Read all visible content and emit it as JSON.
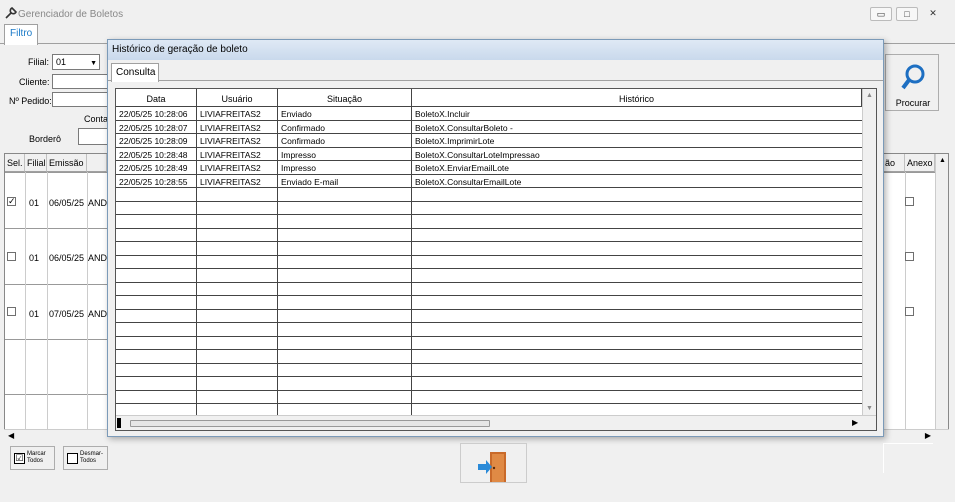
{
  "window": {
    "title": "Gerenciador de Boletos",
    "buttons": {
      "minimize": "▭",
      "maximize": "□",
      "close": "✕"
    }
  },
  "tabs": {
    "filtro": "Filtro"
  },
  "filter": {
    "filial_label": "Filial:",
    "filial_value": "01",
    "cliente_label": "Cliente:",
    "pedido_label": "Nº Pedido:",
    "conta_label": "Conta",
    "bordero_label": "Borderô",
    "procurar_label": "Procurar"
  },
  "grid": {
    "headers": {
      "sel": "Sel.",
      "filial": "Filial",
      "emissao": "Emissão",
      "situacao": "ão",
      "anexo": "Anexo"
    },
    "rows": [
      {
        "filial": "01",
        "emissao": "06/05/25",
        "cliente": "ANDR",
        "checked": true
      },
      {
        "filial": "01",
        "emissao": "06/05/25",
        "cliente": "ANDR",
        "checked": false
      },
      {
        "filial": "01",
        "emissao": "07/05/25",
        "cliente": "ANDR",
        "checked": false
      }
    ]
  },
  "bottom": {
    "marcar": "Marcar Todos",
    "desmarcar": "Desmar- Todos",
    "marcar_check": "☑"
  },
  "modal": {
    "title": "Histórico de geração de boleto",
    "tab": "Consulta",
    "columns": [
      "Data",
      "Usuário",
      "Situação",
      "Histórico"
    ],
    "rows": [
      [
        "22/05/25 10:28:06",
        "LIVIAFREITAS2",
        "Enviado",
        "BoletoX.Incluir"
      ],
      [
        "22/05/25 10:28:07",
        "LIVIAFREITAS2",
        "Confirmado",
        "BoletoX.ConsultarBoleto -"
      ],
      [
        "22/05/25 10:28:09",
        "LIVIAFREITAS2",
        "Confirmado",
        "BoletoX.ImprimirLote"
      ],
      [
        "22/05/25 10:28:48",
        "LIVIAFREITAS2",
        "Impresso",
        "BoletoX.ConsultarLoteImpressao"
      ],
      [
        "22/05/25 10:28:49",
        "LIVIAFREITAS2",
        "Impresso",
        "BoletoX.EnviarEmailLote"
      ],
      [
        "22/05/25 10:28:55",
        "LIVIAFREITAS2",
        "Enviado E-mail",
        "BoletoX.ConsultarEmailLote"
      ]
    ],
    "empty_rows": 16
  }
}
